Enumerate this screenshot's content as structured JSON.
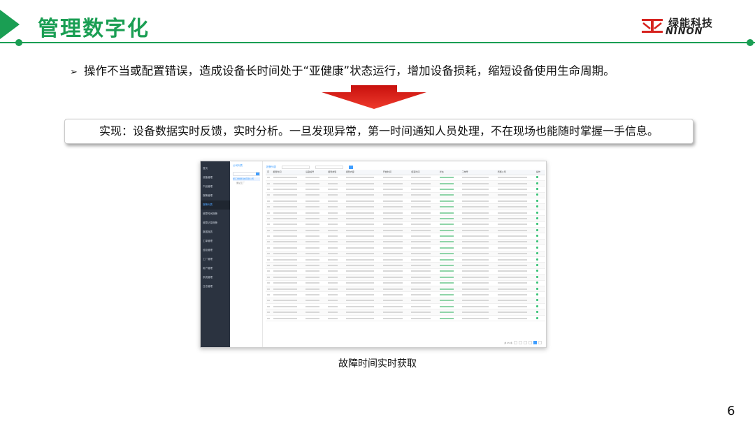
{
  "header": {
    "title": "管理数字化",
    "logo_cn": "绿能科技",
    "logo_en": "NINON",
    "accent_color": "#1a9e53"
  },
  "bullet": {
    "marker": "➢",
    "text": "操作不当或配置错误，造成设备长时间处于“亚健康”状态运行，增加设备损耗，缩短设备使用生命周期。"
  },
  "arrow": {
    "icon": "down-arrow-icon",
    "color": "#e0201c"
  },
  "result_text": "实现：设备数据实时反馈，实时分析。一旦发现异常，第一时间通知人员处理，不在现场也能随时掌握一手信息。",
  "screenshot": {
    "sidebar": [
      "首页",
      "设备管理",
      "产品管理",
      "报警管理",
      "报警列表",
      "故障时间报警",
      "故障记录报警",
      "数据报表",
      "工单管理",
      "巡检管理",
      "工厂管理",
      "用户管理",
      "系统管理",
      "日志管理"
    ],
    "tree_header": "公司列表",
    "tree_node": "浙江绿能科技有限公司",
    "tree_child": "测试工厂",
    "toolbar_title": "报警列表",
    "columns": [
      "序",
      "报警时间",
      "设备编号",
      "报警类型",
      "报警内容",
      "开始时间",
      "结束时间",
      "状态",
      "工单号",
      "所属公司",
      "操作"
    ],
    "rows_count_label": "共 25 条"
  },
  "caption": "故障时间实时获取",
  "page_number": "6"
}
